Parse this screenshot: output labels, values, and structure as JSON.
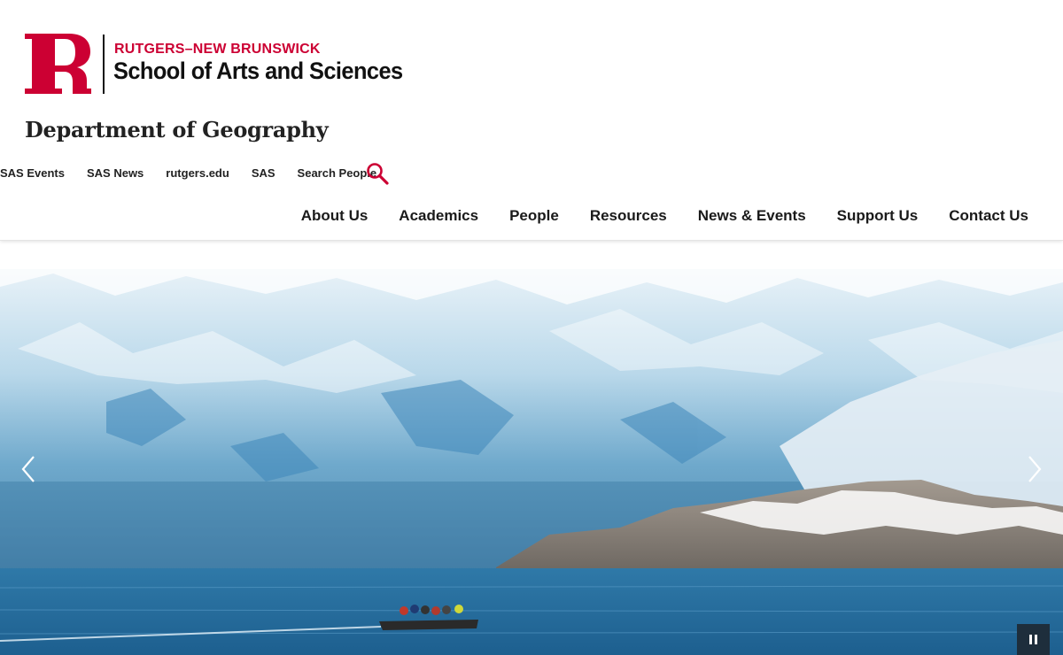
{
  "branding": {
    "logo_letter": "R",
    "line1": "RUTGERS–NEW BRUNSWICK",
    "line2": "School of Arts and Sciences",
    "brand_color": "#cc0033"
  },
  "department": {
    "title": "Department of Geography"
  },
  "utility_nav": {
    "items": [
      "SAS Events",
      "SAS News",
      "rutgers.edu",
      "SAS",
      "Search People"
    ],
    "search_icon": "search-icon"
  },
  "main_nav": {
    "items": [
      "About Us",
      "Academics",
      "People",
      "Resources",
      "News & Events",
      "Support Us",
      "Contact Us"
    ]
  },
  "hero": {
    "image_subject": "glacier-with-inflatable-boat",
    "prev_icon": "chevron-left-icon",
    "next_icon": "chevron-right-icon",
    "pause_icon": "pause-icon"
  }
}
